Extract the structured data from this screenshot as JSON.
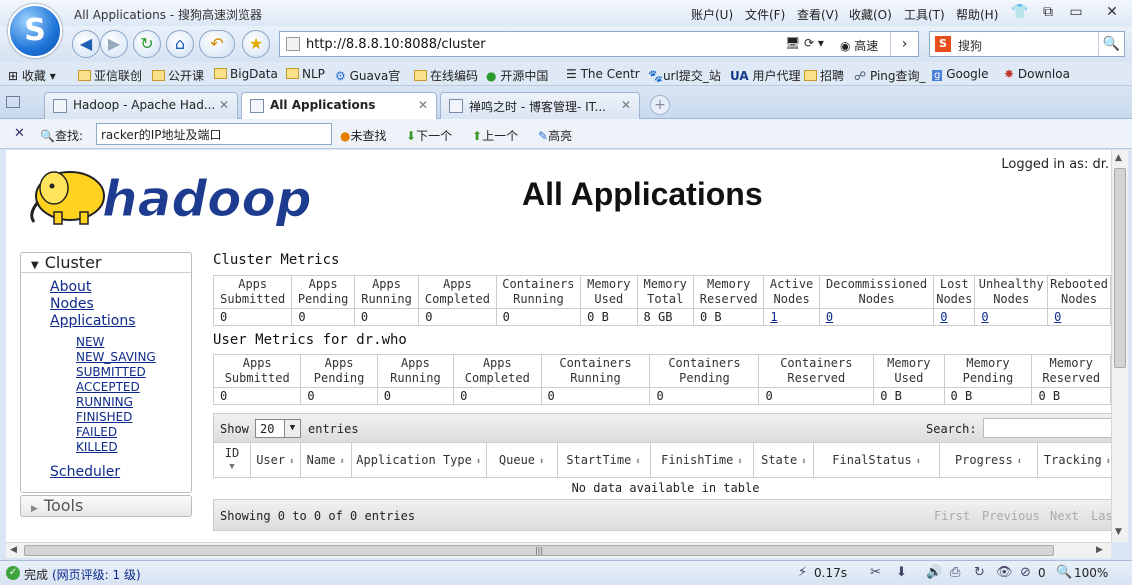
{
  "window": {
    "title": "All Applications - 搜狗高速浏览器",
    "menus": [
      "账户(U)",
      "文件(F)",
      "查看(V)",
      "收藏(O)",
      "工具(T)",
      "帮助(H)"
    ]
  },
  "address_bar": {
    "url": "http://8.8.8.10:8088/cluster",
    "speed_label": "高速"
  },
  "search_bar": {
    "placeholder": "搜狗"
  },
  "bookmarks": [
    "收藏",
    "亚信联创",
    "公开课",
    "BigData",
    "NLP",
    "Guava官",
    "在线编码",
    "开源中国",
    "The Centr",
    "url提交_站",
    "用户代理",
    "招聘",
    "Ping查询_",
    "Google",
    "Downloa"
  ],
  "tabs": [
    {
      "label": "Hadoop - Apache Had...",
      "active": false
    },
    {
      "label": "All Applications",
      "active": true
    },
    {
      "label": "禅鸣之时 - 博客管理- IT...",
      "active": false
    }
  ],
  "findbar": {
    "label": "查找:",
    "query": "racker的IP地址及端口",
    "not_found": "未查找",
    "next": "下一个",
    "prev": "上一个",
    "highlight": "高亮"
  },
  "page": {
    "logged_in": "Logged in as: dr.",
    "title": "All Applications",
    "logo_text": "hadoop"
  },
  "sidebar": {
    "cluster_header": "Cluster",
    "links": [
      "About",
      "Nodes",
      "Applications"
    ],
    "app_states": [
      "NEW",
      "NEW_SAVING",
      "SUBMITTED",
      "ACCEPTED",
      "RUNNING",
      "FINISHED",
      "FAILED",
      "KILLED"
    ],
    "scheduler": "Scheduler",
    "tools_header": "Tools"
  },
  "cluster_metrics": {
    "title": "Cluster Metrics",
    "headers": [
      "Apps Submitted",
      "Apps Pending",
      "Apps Running",
      "Apps Completed",
      "Containers Running",
      "Memory Used",
      "Memory Total",
      "Memory Reserved",
      "Active Nodes",
      "Decommissioned Nodes",
      "Lost Nodes",
      "Unhealthy Nodes",
      "Rebooted Nodes"
    ],
    "values": [
      "0",
      "0",
      "0",
      "0",
      "0",
      "0 B",
      "8 GB",
      "0 B",
      "1",
      "0",
      "0",
      "0",
      "0"
    ]
  },
  "user_metrics": {
    "title": "User Metrics for dr.who",
    "headers": [
      "Apps Submitted",
      "Apps Pending",
      "Apps Running",
      "Apps Completed",
      "Containers Running",
      "Containers Pending",
      "Containers Reserved",
      "Memory Used",
      "Memory Pending",
      "Memory Reserved"
    ],
    "values": [
      "0",
      "0",
      "0",
      "0",
      "0",
      "0",
      "0",
      "0 B",
      "0 B",
      "0 B"
    ]
  },
  "apps_table": {
    "show_label": "Show",
    "entries_value": "20",
    "entries_label": "entries",
    "search_label": "Search:",
    "columns": [
      "ID",
      "User",
      "Name",
      "Application Type",
      "Queue",
      "StartTime",
      "FinishTime",
      "State",
      "FinalStatus",
      "Progress",
      "Tracking"
    ],
    "empty_message": "No data available in table",
    "info": "Showing 0 to 0 of 0 entries",
    "pager": [
      "First",
      "Previous",
      "Next",
      "Last"
    ]
  },
  "statusbar": {
    "status": "完成",
    "rating": "(网页评级: 1 级)",
    "load_time": "0.17s",
    "count": "0",
    "zoom": "100%"
  }
}
